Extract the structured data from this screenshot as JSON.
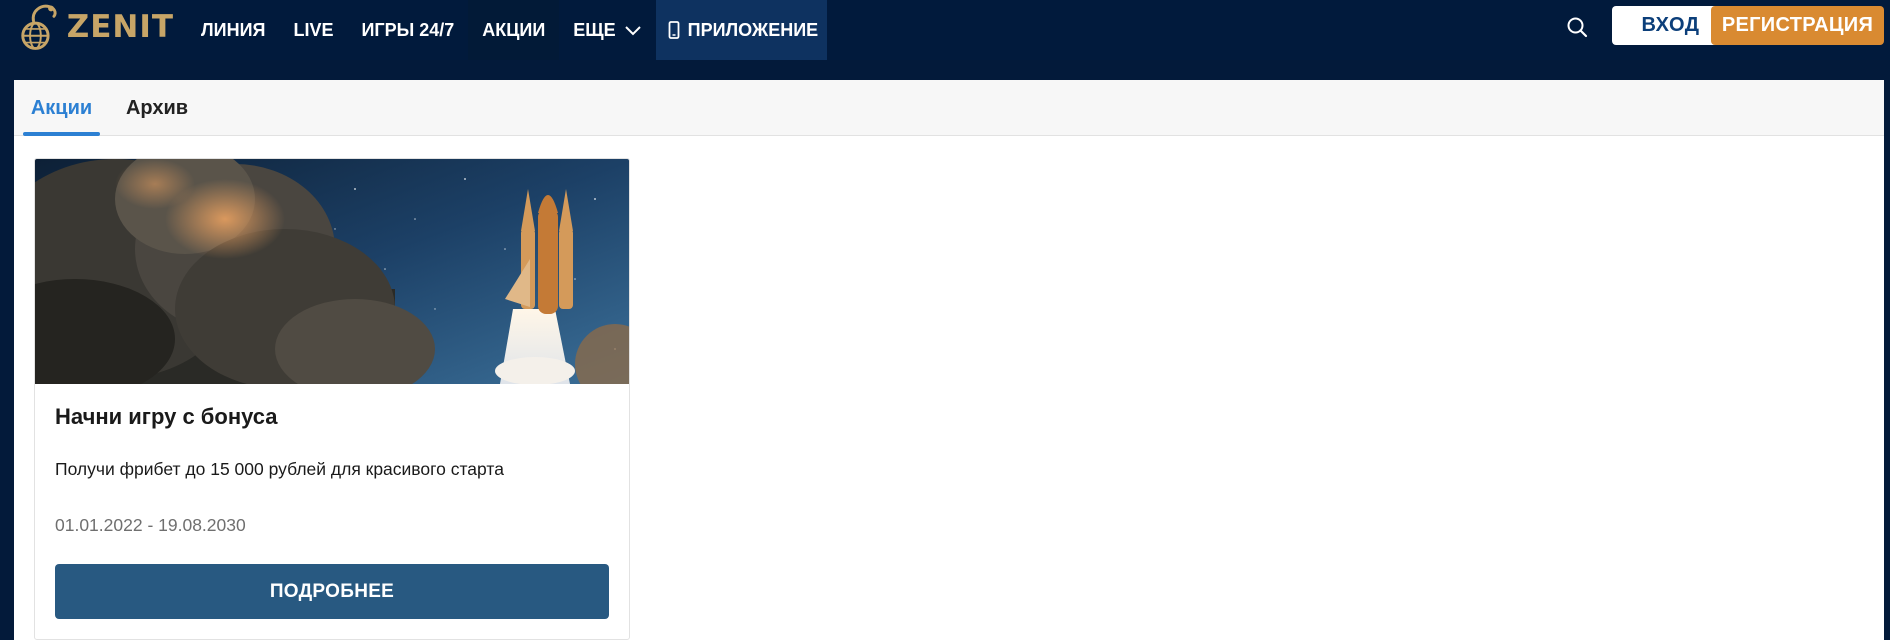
{
  "brand": {
    "logo_text": "ZENIT",
    "logo_color": "#c7a567"
  },
  "nav": {
    "items": [
      {
        "label": "ЛИНИЯ"
      },
      {
        "label": "LIVE"
      },
      {
        "label": "ИГРЫ 24/7"
      },
      {
        "label": "АКЦИИ",
        "active": true
      },
      {
        "label": "ЕЩЕ",
        "icon": "chevron-down-icon"
      },
      {
        "label": "ПРИЛОЖЕНИЕ",
        "icon": "phone-icon"
      }
    ]
  },
  "header_actions": {
    "search_icon": "search-icon",
    "login_label": "ВХОД",
    "register_label": "РЕГИСТРАЦИЯ"
  },
  "tabs": [
    {
      "label": "Акции",
      "active": true
    },
    {
      "label": "Архив",
      "active": false
    }
  ],
  "promo": {
    "image": "rocket-launch-image",
    "title": "Начни игру с бонуса",
    "description": "Получи фрибет до 15 000 рублей для красивого старта",
    "dates": "01.01.2022 - 19.08.2030",
    "button_label": "ПОДРОБНЕЕ"
  },
  "colors": {
    "header_bg": "#011a3c",
    "accent_blue": "#2c80d3",
    "register_orange": "#d98a31",
    "details_button": "#285981"
  }
}
